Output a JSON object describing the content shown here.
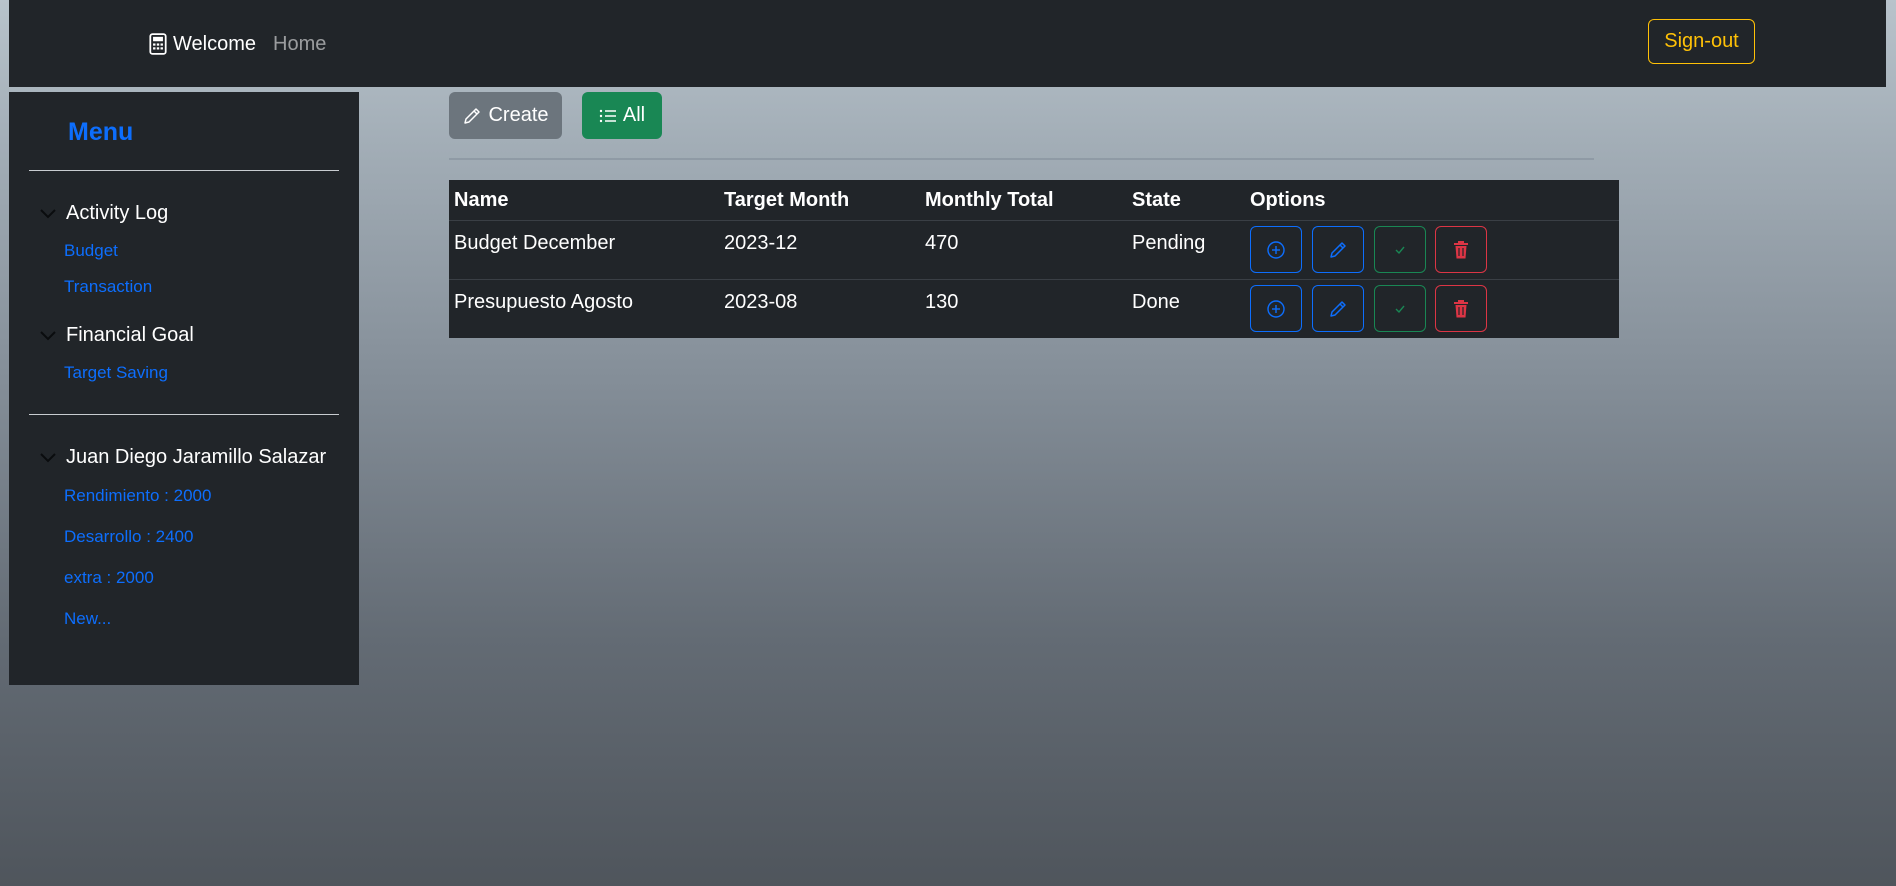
{
  "navbar": {
    "brand_label": "Welcome",
    "brand_icon": "calculator-icon",
    "home_label": "Home",
    "signout_label": "Sign-out"
  },
  "sidebar": {
    "title": "Menu",
    "groups": [
      {
        "label": "Activity Log",
        "links": [
          "Budget",
          "Transaction"
        ]
      },
      {
        "label": "Financial Goal",
        "links": [
          "Target Saving"
        ]
      },
      {
        "label": "Juan Diego Jaramillo Salazar",
        "links": [
          "Rendimiento : 2000",
          "Desarrollo : 2400",
          "extra : 2000",
          "New..."
        ]
      }
    ]
  },
  "toolbar": {
    "create_label": "Create",
    "all_label": "All"
  },
  "table": {
    "headers": [
      "Name",
      "Target Month",
      "Monthly Total",
      "State",
      "Options"
    ],
    "rows": [
      {
        "name": "Budget December",
        "month": "2023-12",
        "total": "470",
        "state": "Pending"
      },
      {
        "name": "Presupuesto Agosto",
        "month": "2023-08",
        "total": "130",
        "state": "Done"
      }
    ]
  },
  "colors": {
    "dark": "#212529",
    "primary": "#0d6efd",
    "success": "#198754",
    "danger": "#dc3545",
    "warning": "#ffc107",
    "secondary": "#6c757d"
  }
}
